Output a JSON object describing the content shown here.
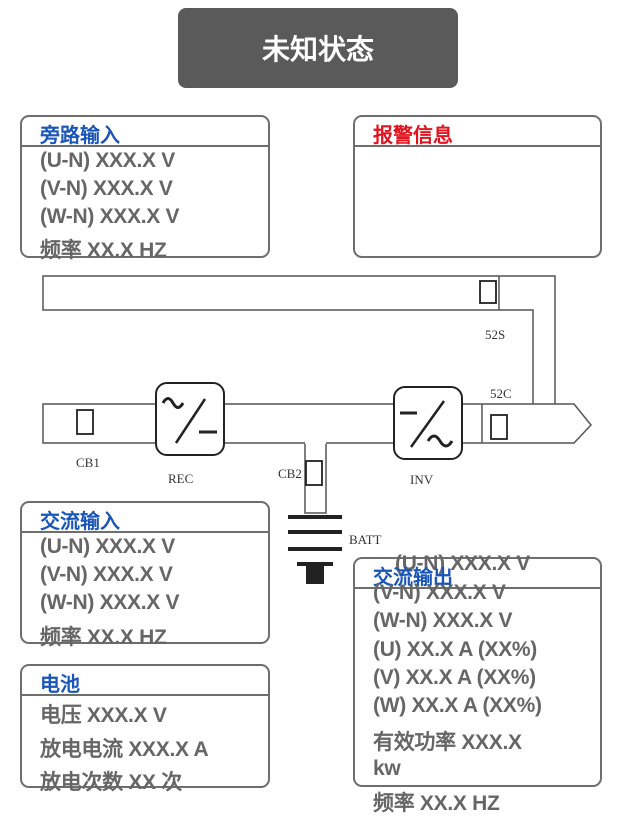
{
  "status": {
    "title": "未知状态"
  },
  "bypass_input": {
    "title": "旁路输入",
    "lines": [
      "(U-N)  XXX.X V",
      "(V-N)  XXX.X V",
      "(W-N) XXX.X V",
      "频率   XX.X HZ"
    ]
  },
  "alarm": {
    "title": "报警信息"
  },
  "ac_input": {
    "title": "交流输入",
    "lines": [
      "(U-N)  XXX.X V",
      "(V-N)  XXX.X V",
      "(W-N) XXX.X V",
      "频率   XX.X HZ"
    ]
  },
  "battery": {
    "title": "电池",
    "lines": [
      "电压 XXX.X V",
      "放电电流 XXX.X A",
      "放电次数 XX 次"
    ]
  },
  "ac_output": {
    "title": "交流输出",
    "overflow_line": "(U-N)  XXX.X V",
    "lines": [
      "(V-N)  XXX.X V",
      "(W-N) XXX.X V",
      "(U)  XX.X A (XX%)",
      "(V)  XX.X A (XX%)",
      "(W)  XX.X A (XX%)",
      "有效功率 XXX.X",
      "kw",
      "频率   XX.X HZ"
    ]
  },
  "diagram": {
    "labels": {
      "cb1": "CB1",
      "rec": "REC",
      "cb2": "CB2",
      "inv": "INV",
      "batt": "BATT",
      "s52s": "52S",
      "s52c": "52C"
    }
  }
}
